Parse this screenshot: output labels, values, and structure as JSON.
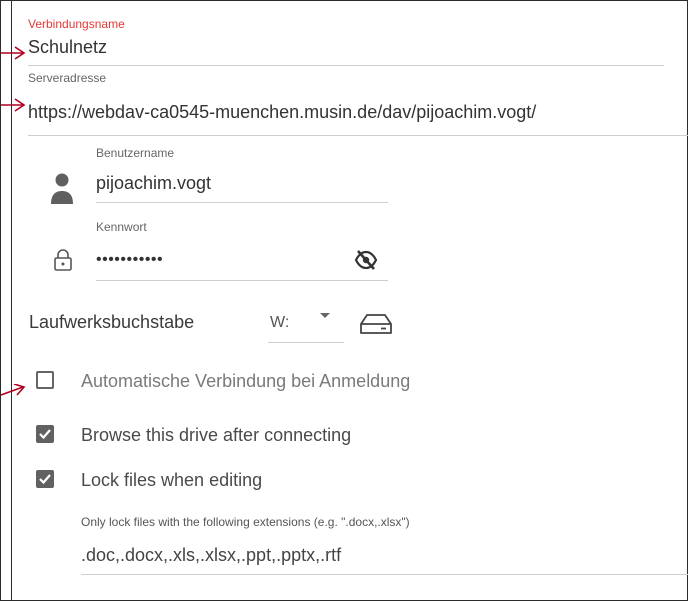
{
  "connection_name": {
    "label": "Verbindungsname",
    "value": "Schulnetz"
  },
  "server_address": {
    "label": "Serveradresse",
    "value": "https://webdav-ca0545-muenchen.musin.de/dav/pijoachim.vogt/"
  },
  "username": {
    "label": "Benutzername",
    "value": "pijoachim.vogt",
    "icon": "user-icon"
  },
  "password": {
    "label": "Kennwort",
    "value": "•••••••••••",
    "icon": "lock-icon",
    "toggle_icon": "eye-off-icon"
  },
  "drive_letter": {
    "label": "Laufwerksbuchstabe",
    "value": "W:",
    "icon": "hard-drive-icon"
  },
  "options": [
    {
      "label": "Automatische Verbindung bei Anmeldung",
      "checked": false
    },
    {
      "label": "Browse this drive after connecting",
      "checked": true
    },
    {
      "label": "Lock files when editing",
      "checked": true
    }
  ],
  "lock_extensions": {
    "label": "Only lock files with the following extensions (e.g. \".docx,.xlsx\")",
    "value": ".doc,.docx,.xls,.xlsx,.ppt,.pptx,.rtf"
  },
  "colors": {
    "focus_label": "#e53935",
    "annotation_arrow": "#b00020",
    "checkbox_fill": "#616161"
  }
}
